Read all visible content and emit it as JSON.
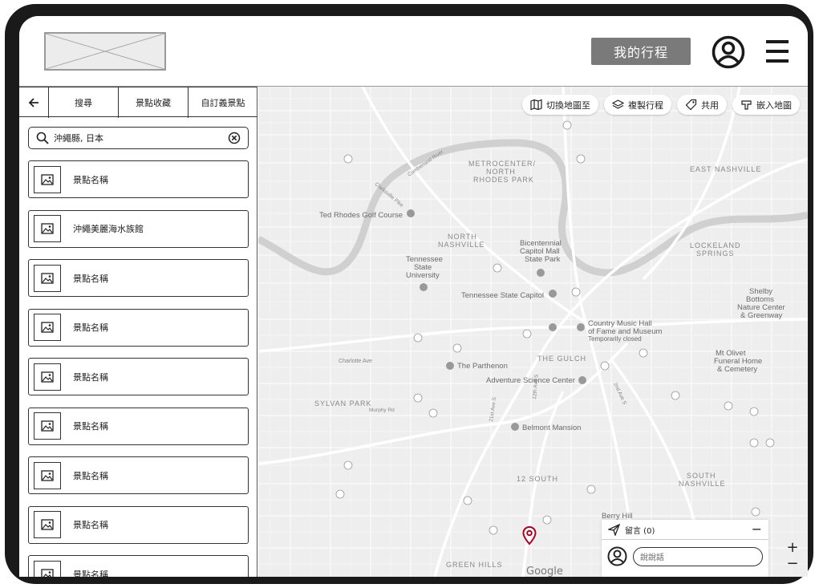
{
  "header": {
    "my_trip_label": "我的行程"
  },
  "sidebar": {
    "tabs": [
      {
        "label": "搜尋"
      },
      {
        "label": "景點收藏"
      },
      {
        "label": "自訂義景點"
      }
    ],
    "search": {
      "value": "沖繩縣, 日本"
    },
    "items": [
      {
        "label": "景點名稱"
      },
      {
        "label": "沖繩美麗海水族館"
      },
      {
        "label": "景點名稱"
      },
      {
        "label": "景點名稱"
      },
      {
        "label": "景點名稱"
      },
      {
        "label": "景點名稱"
      },
      {
        "label": "景點名稱"
      },
      {
        "label": "景點名稱"
      },
      {
        "label": "景點名稱"
      }
    ]
  },
  "map": {
    "toolbar": [
      {
        "label": "切換地圖至",
        "icon": "map-icon"
      },
      {
        "label": "複製行程",
        "icon": "layers-icon"
      },
      {
        "label": "共用",
        "icon": "tag-icon"
      },
      {
        "label": "嵌入地圖",
        "icon": "embed-icon"
      }
    ],
    "areas": [
      "METROCENTER/",
      "NORTH",
      "RHODES PARK",
      "EAST NASHVILLE",
      "NORTH",
      "NASHVILLE",
      "LOCKELAND",
      "SPRINGS",
      "THE GULCH",
      "SYLVAN PARK",
      "12 SOUTH",
      "SOUTH",
      "NASHVILLE",
      "GREEN HILLS"
    ],
    "pois": [
      "Ted Rhodes Golf Course",
      "Tennessee",
      "State",
      "University",
      "Bicentennial",
      "Capitol Mall",
      "State Park",
      "Tennessee State Capitol",
      "Country Music Hall",
      "of Fame and Museum",
      "Temporarily closed",
      "The Parthenon",
      "Adventure Science Center",
      "Belmont Mansion",
      "Mt Olivet",
      "Funeral Home",
      "& Cemetery",
      "Shelby",
      "Bottoms",
      "Nature Center",
      "& Greenway",
      "Berry Hill"
    ],
    "streets": [
      "Charlotte Ave",
      "Clarksville Pike",
      "Cumberland River",
      "21st Ave S",
      "2nd Ave S",
      "12th Ave S",
      "Murphy Rd"
    ],
    "google_label": "Google",
    "comment": {
      "title": "留言 (0)",
      "placeholder": "說說話"
    },
    "zoom_in": "+",
    "zoom_out": "−"
  }
}
